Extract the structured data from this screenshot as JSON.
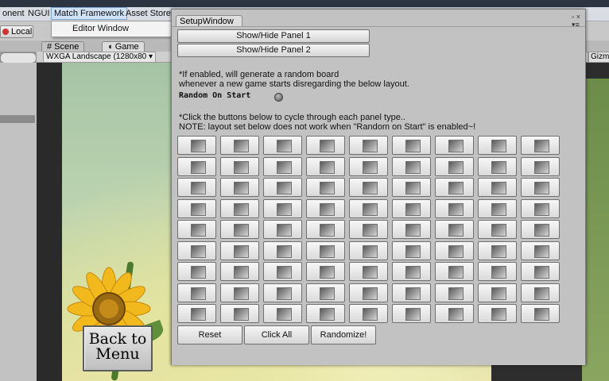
{
  "menubar": {
    "items": [
      "onent",
      "NGUI",
      "Match Framework",
      "Asset Store To"
    ],
    "active_index": 2
  },
  "dropdown": {
    "item": "Editor Window"
  },
  "toolbar": {
    "local_label": "Local"
  },
  "tabs": {
    "scene": "# Scene",
    "game": "Game",
    "game_icon": "pacman-icon"
  },
  "viewport": {
    "aspect": "WXGA Landscape (1280x80 ▾",
    "right_a": "s",
    "right_b": "Gizm"
  },
  "game": {
    "back_button": "Back to Menu",
    "back_line1": "Back to",
    "back_line2": "Menu"
  },
  "setup_window": {
    "title": "SetupWindow",
    "controls": "▫ ×",
    "menu_glyph": "▾≡",
    "panel1_button": "Show/Hide Panel 1",
    "panel2_button": "Show/Hide Panel 2",
    "random_info_line1": "*If enabled, will generate a random board",
    "random_info_line2": "whenever a new game starts disregarding the below layout.",
    "random_label": "Random On Start",
    "random_on_start": false,
    "cycle_info_line1": "*Click the buttons below to cycle through each panel type..",
    "cycle_info_line2": "NOTE: layout set below does not work when \"Random on Start\" is enabled~!",
    "grid": {
      "rows": 9,
      "cols": 9
    },
    "reset_button": "Reset",
    "click_all_button": "Click All",
    "randomize_button": "Randomize!"
  }
}
